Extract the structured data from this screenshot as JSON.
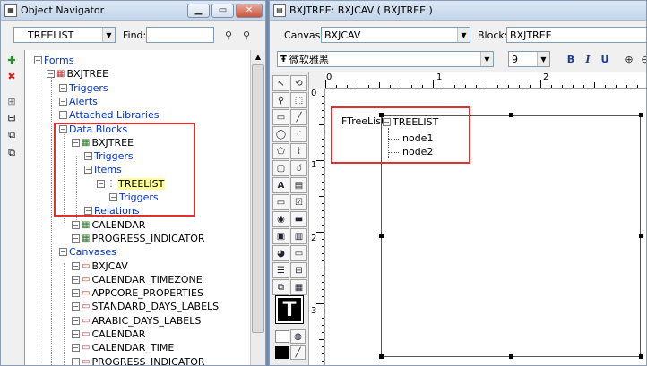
{
  "navigator": {
    "title": "Object Navigator",
    "search_value": "TREELIST",
    "find_label": "Find:",
    "find_value": "",
    "tree": [
      {
        "label": "Forms",
        "depth": 0,
        "icon": "forms-icon",
        "color": "blue"
      },
      {
        "label": "BXJTREE",
        "depth": 1,
        "icon": "form-module-icon",
        "color": "black"
      },
      {
        "label": "Triggers",
        "depth": 2,
        "icon": "none",
        "color": "blue"
      },
      {
        "label": "Alerts",
        "depth": 2,
        "icon": "none",
        "color": "blue"
      },
      {
        "label": "Attached Libraries",
        "depth": 2,
        "icon": "none",
        "color": "blue"
      },
      {
        "label": "Data Blocks",
        "depth": 2,
        "icon": "none",
        "color": "blue"
      },
      {
        "label": "BXJTREE",
        "depth": 3,
        "icon": "data-block-icon",
        "color": "black"
      },
      {
        "label": "Triggers",
        "depth": 4,
        "icon": "none",
        "color": "blue"
      },
      {
        "label": "Items",
        "depth": 4,
        "icon": "none",
        "color": "blue"
      },
      {
        "label": "TREELIST",
        "depth": 5,
        "icon": "tree-item-icon",
        "color": "black",
        "selected": true
      },
      {
        "label": "Triggers",
        "depth": 6,
        "icon": "none",
        "color": "blue"
      },
      {
        "label": "Relations",
        "depth": 4,
        "icon": "none",
        "color": "blue"
      },
      {
        "label": "CALENDAR",
        "depth": 3,
        "icon": "data-block-icon",
        "color": "black"
      },
      {
        "label": "PROGRESS_INDICATOR",
        "depth": 3,
        "icon": "data-block-icon",
        "color": "black"
      },
      {
        "label": "Canvases",
        "depth": 2,
        "icon": "none",
        "color": "blue"
      },
      {
        "label": "BXJCAV",
        "depth": 3,
        "icon": "canvas-icon",
        "color": "black"
      },
      {
        "label": "CALENDAR_TIMEZONE",
        "depth": 3,
        "icon": "canvas-icon",
        "color": "black"
      },
      {
        "label": "APPCORE_PROPERTIES",
        "depth": 3,
        "icon": "canvas-icon",
        "color": "black"
      },
      {
        "label": "STANDARD_DAYS_LABELS",
        "depth": 3,
        "icon": "canvas-icon",
        "color": "black"
      },
      {
        "label": "ARABIC_DAYS_LABELS",
        "depth": 3,
        "icon": "canvas-icon",
        "color": "black"
      },
      {
        "label": "CALENDAR",
        "depth": 3,
        "icon": "canvas-icon",
        "color": "black"
      },
      {
        "label": "CALENDAR_TIME",
        "depth": 3,
        "icon": "canvas-icon",
        "color": "black"
      },
      {
        "label": "PROGRESS_INDICATOR",
        "depth": 3,
        "icon": "canvas-icon",
        "color": "black"
      }
    ]
  },
  "editor": {
    "title": "BXJTREE: BXJCAV ( BXJTREE )",
    "canvas_label": "Canvas:",
    "canvas_value": "BXJCAV",
    "block_label": "Block:",
    "block_value": "BXJTREE",
    "font_value": "微软雅黑",
    "font_size": "9",
    "bold": "B",
    "italic": "I",
    "underline": "U",
    "ruler_h": [
      "0",
      "1",
      "2"
    ],
    "ruler_v": [
      "0",
      "1",
      "2",
      "3"
    ],
    "tree_prompt": "FTreeList",
    "tree_root": "TREELIST",
    "tree_nodes": [
      "node1",
      "node2"
    ]
  },
  "colors": {
    "annotation": "#e03030",
    "link": "#0033cc",
    "highlight": "#ffff99"
  }
}
